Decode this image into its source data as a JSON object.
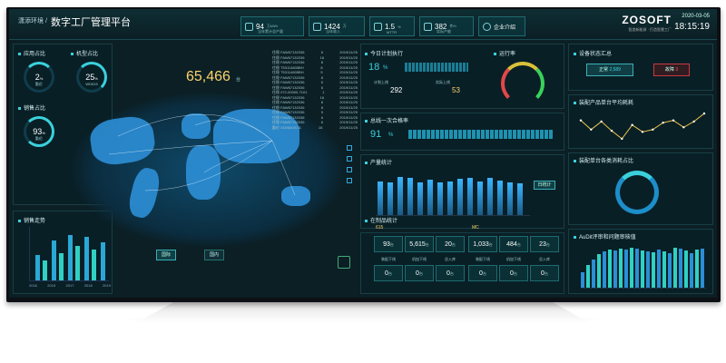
{
  "header": {
    "crumb": "潇添环境 /",
    "title": "数字工厂管理平台",
    "brand": "ZOSOFT",
    "brand_sub": "智造新能源 · 打造智慧工厂",
    "date": "2020-03-05",
    "time": "18:15:19"
  },
  "kpis": [
    {
      "value": "94",
      "unit": "万kWh",
      "label": "当年累计总产量"
    },
    {
      "value": "1424",
      "unit": "万",
      "label": "当年收入"
    },
    {
      "value": "1.5",
      "unit": "%",
      "label": "MTTR"
    },
    {
      "value": "382",
      "unit": "件/h",
      "label": "实际产能"
    },
    {
      "value": "",
      "unit": "",
      "label": "企业介绍"
    }
  ],
  "left": {
    "app_title": "应用占比",
    "app_value": "2",
    "app_unit": "%",
    "app_sub": "勤伦",
    "machine_title": "机型占比",
    "machine_value": "25",
    "machine_unit": "%",
    "machine_sub": "WD615",
    "sales_title": "销售占比",
    "sales_value": "93",
    "sales_unit": "%",
    "sales_sub": "勤伦",
    "trend_title": "销售走势",
    "trend_years": [
      "2016",
      "2015",
      "2017",
      "2018",
      "2019"
    ]
  },
  "center": {
    "big_value": "65,466",
    "big_unit": "台",
    "btn_domestic": "国际",
    "btn_inland": "国内",
    "table": [
      [
        "住稳 FAW67132036",
        "6",
        "2019/11/25"
      ],
      [
        "住稳 FAW67132036",
        "16",
        "2019/11/25"
      ],
      [
        "住稳 FAW67132036",
        "8",
        "2019/11/25"
      ],
      [
        "住稳 T53114805BH",
        "8",
        "2019/11/25"
      ],
      [
        "住稳 T53114805BH",
        "5",
        "2019/11/25"
      ],
      [
        "住稳 FAW67132036",
        "8",
        "2019/11/25"
      ],
      [
        "住稳 FAW67132036",
        "6",
        "2019/11/25"
      ],
      [
        "住稳 FAW67132036",
        "6",
        "2019/11/25"
      ],
      [
        "住稳 072-00000-7101",
        "1",
        "2019/11/25"
      ],
      [
        "住稳 FAW67132036",
        "16",
        "2019/11/25"
      ],
      [
        "住稳 FAW67132036",
        "8",
        "2019/11/25"
      ],
      [
        "住稳 FAW67132036",
        "8",
        "2019/11/25"
      ],
      [
        "住稳 FAW67132036",
        "5",
        "2019/11/25"
      ],
      [
        "住稳 FAW67132036",
        "6",
        "2019/11/25"
      ],
      [
        "住稳 FAW67132036",
        "6",
        "2019/11/25"
      ],
      [
        "勤伦 415/600/C01",
        "16",
        "2019/11/25"
      ]
    ]
  },
  "plan": {
    "title": "今日计划执行",
    "pct": "18",
    "pct_unit": "%",
    "plan_label": "计划上线",
    "plan_value": "292",
    "actual_label": "实际上线",
    "actual_value": "53",
    "run_title": "运行率",
    "first_title": "总线一次合格率",
    "first_pct": "91",
    "first_unit": "%"
  },
  "production": {
    "title": "产量统计",
    "btn": "日统计",
    "bars": [
      0.72,
      0.7,
      0.8,
      0.78,
      0.69,
      0.75,
      0.7,
      0.72,
      0.76,
      0.78,
      0.72,
      0.78,
      0.74,
      0.7,
      0.68
    ]
  },
  "stock": {
    "title": "在制品统计",
    "g1": "615",
    "g2": "MC",
    "row1": [
      {
        "v": "93",
        "u": "台"
      },
      {
        "v": "5,615",
        "u": "台"
      },
      {
        "v": "20",
        "u": "台"
      },
      {
        "v": "1,033",
        "u": "台"
      },
      {
        "v": "484",
        "u": "台"
      },
      {
        "v": "23",
        "u": "台"
      }
    ],
    "row2_labels": [
      "装配下线",
      "机加下线",
      "总入库",
      "装配下线",
      "机加下线",
      "总入库"
    ],
    "row2": [
      {
        "v": "0",
        "u": "台"
      },
      {
        "v": "0",
        "u": "台"
      },
      {
        "v": "0",
        "u": "台"
      },
      {
        "v": "0",
        "u": "台"
      },
      {
        "v": "0",
        "u": "台"
      },
      {
        "v": "0",
        "u": "台"
      }
    ]
  },
  "right": {
    "status_title": "设备状态汇总",
    "normal_label": "正常",
    "normal_value": "2,589",
    "fault_label": "故障",
    "fault_value": "3",
    "unit_title": "装配产品单台平均耗耗",
    "consume_title": "装配单台各类消耗占比",
    "audit_title": "AuDit评审和问题审核值",
    "line_values": [
      6,
      5.2,
      5.9,
      5.1,
      4.4,
      5.6,
      5,
      5.2,
      5.8,
      6,
      5.4,
      5.9,
      6.6
    ],
    "audit_bars": [
      0.35,
      0.5,
      0.62,
      0.75,
      0.8,
      0.85,
      0.82,
      0.86,
      0.84,
      0.88,
      0.87,
      0.82,
      0.8,
      0.78,
      0.84,
      0.8,
      0.76,
      0.88,
      0.86,
      0.83,
      0.77,
      0.84,
      0.86
    ]
  }
}
